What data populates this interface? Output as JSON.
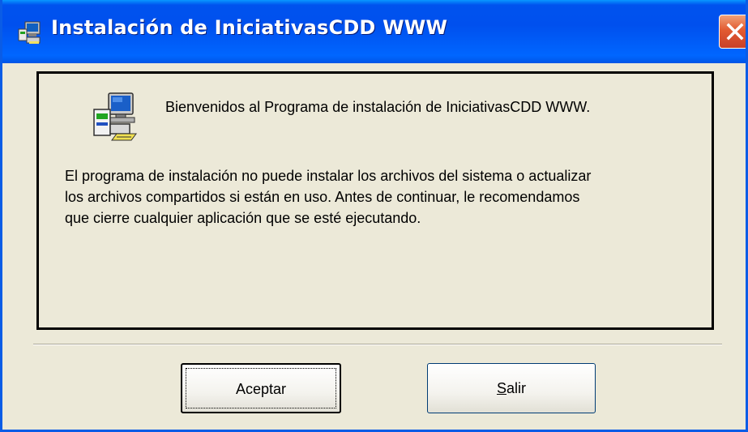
{
  "window": {
    "title": "Instalación de IniciativasCDD WWW",
    "colors": {
      "titlebar": "#0054e3",
      "close_button": "#e25b31",
      "face": "#ece9d8"
    }
  },
  "icons": {
    "title": "setup-computer-icon",
    "main": "setup-computer-icon",
    "close": "close-icon"
  },
  "main": {
    "welcome": "Bienvenidos al Programa de instalación de IniciativasCDD WWW.",
    "message_lines": [
      "El programa de instalación no puede instalar los archivos del sistema o actualizar",
      "los archivos compartidos si están en uso. Antes de continuar, le recomendamos",
      "que cierre cualquier aplicación que se esté ejecutando."
    ]
  },
  "buttons": {
    "ok_label": "Aceptar",
    "exit_label_accel": "S",
    "exit_label_rest": "alir"
  }
}
